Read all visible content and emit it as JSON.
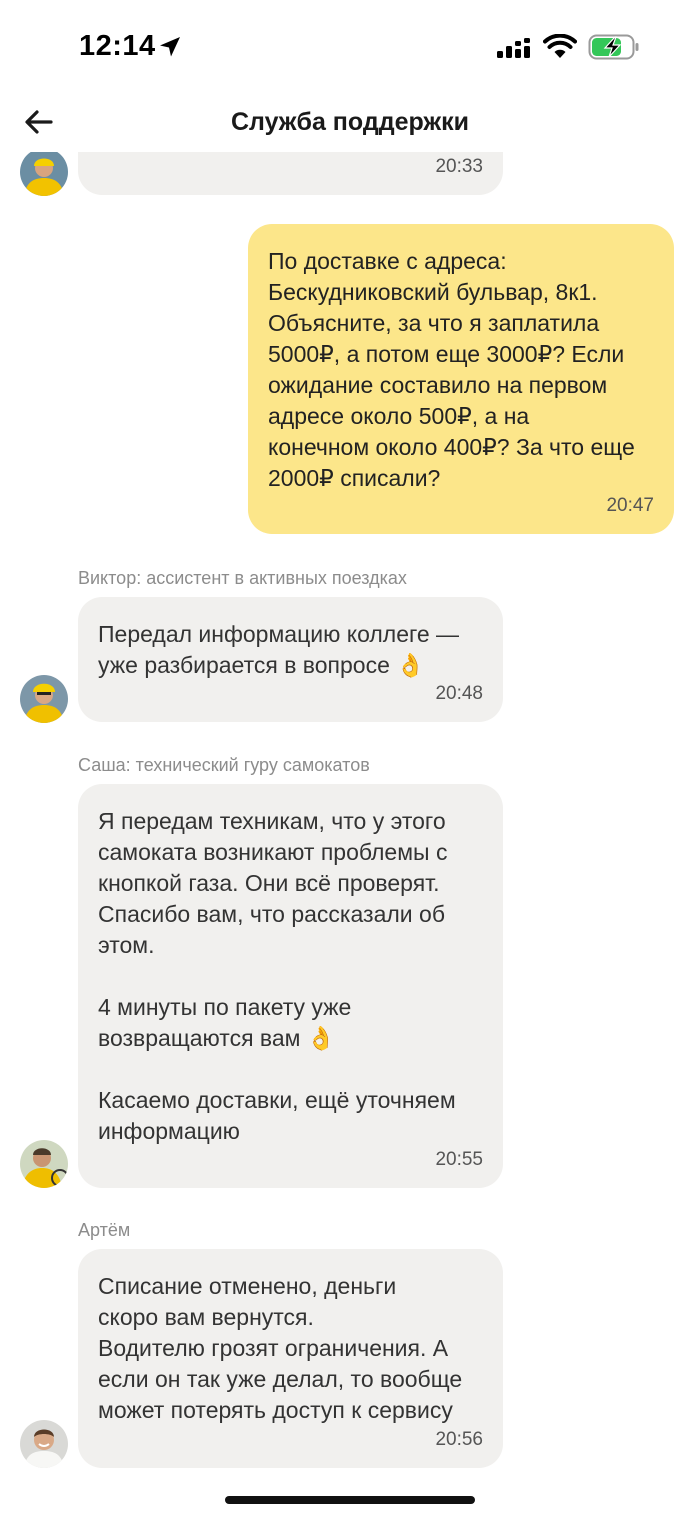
{
  "status_bar": {
    "time": "12:14",
    "location_icon": "location-arrow-icon",
    "signal_icon": "cellular-signal-icon",
    "wifi_icon": "wifi-icon",
    "battery_icon": "battery-charging-icon",
    "battery_color": "#34c759"
  },
  "header": {
    "back_icon": "arrow-left-icon",
    "title": "Служба поддержки"
  },
  "colors": {
    "incoming_bubble": "#f1f0ee",
    "outgoing_bubble": "#fce68a",
    "sender_label": "#8c8c8c"
  },
  "messages": [
    {
      "direction": "incoming",
      "sender": "",
      "text": "",
      "time": "20:33"
    },
    {
      "direction": "outgoing",
      "text": "По доставке с адреса:\nБескудниковский бульвар, 8к1.\nОбъясните, за что я заплатила\n5000₽, а потом еще 3000₽? Если\nожидание составило на первом\nадресе около 500₽, а на\nконечном около 400₽? За что еще\n2000₽ списали?",
      "time": "20:47"
    },
    {
      "direction": "incoming",
      "sender": "Виктор: ассистент в активных поездках",
      "text": "Передал информацию коллеге —\nуже разбирается в вопросе 👌",
      "time": "20:48"
    },
    {
      "direction": "incoming",
      "sender": "Саша: технический гуру самокатов",
      "text": "Я передам техникам, что у этого\nсамоката возникают проблемы с\nкнопкой газа. Они всё проверят.\nСпасибо вам, что рассказали об\nэтом.\n\n4 минуты по пакету уже\nвозвращаются вам 👌\n\nКасаемо доставки, ещё уточняем\nинформацию",
      "time": "20:55"
    },
    {
      "direction": "incoming",
      "sender": "Артём",
      "text": "Списание отменено, деньги\nскоро вам вернутся.\nВодителю грозят ограничения. А\nесли он так уже делал, то вообще\nможет потерять доступ к сервису",
      "time": "20:56"
    }
  ]
}
